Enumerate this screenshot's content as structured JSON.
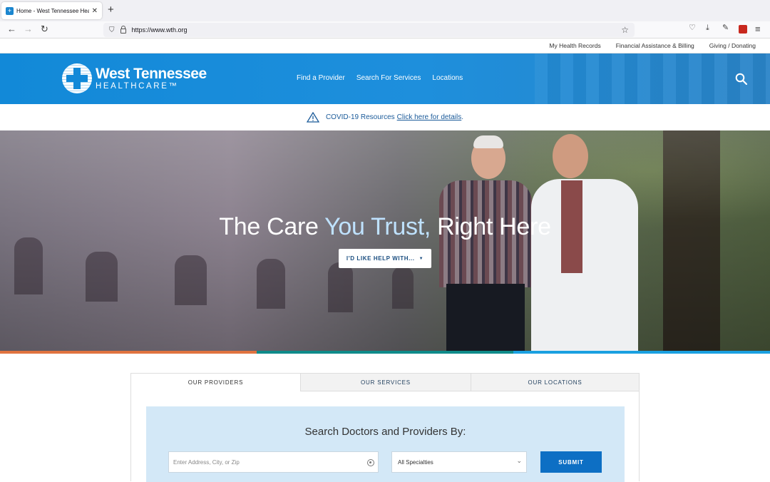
{
  "browser": {
    "tab_title": "Home - West Tennessee Healt",
    "url": "https://www.wth.org"
  },
  "utility_nav": [
    "My Health Records",
    "Financial Assistance & Billing",
    "Giving / Donating"
  ],
  "header": {
    "logo_line1": "West Tennessee",
    "logo_line2": "HEALTHCARE™",
    "nav": [
      "Find a Provider",
      "Search For Services",
      "Locations"
    ],
    "brand_color": "#1289d8"
  },
  "alert": {
    "text": "COVID-19 Resources",
    "link": "Click here for details",
    "suffix": "."
  },
  "hero": {
    "title_part1": "The Care ",
    "title_accent": "You Trust,",
    "title_part2": " Right Here",
    "button_label": "I'D LIKE HELP WITH...",
    "stripe_colors": [
      "#e0733f",
      "#0f8b8a",
      "#1aa0e0"
    ]
  },
  "finder": {
    "tabs": [
      "OUR PROVIDERS",
      "OUR SERVICES",
      "OUR LOCATIONS"
    ],
    "heading": "Search Doctors and Providers By:",
    "address_placeholder": "Enter Address, City, or Zip",
    "specialty_selected": "All Specialties",
    "submit_label": "SUBMIT"
  }
}
